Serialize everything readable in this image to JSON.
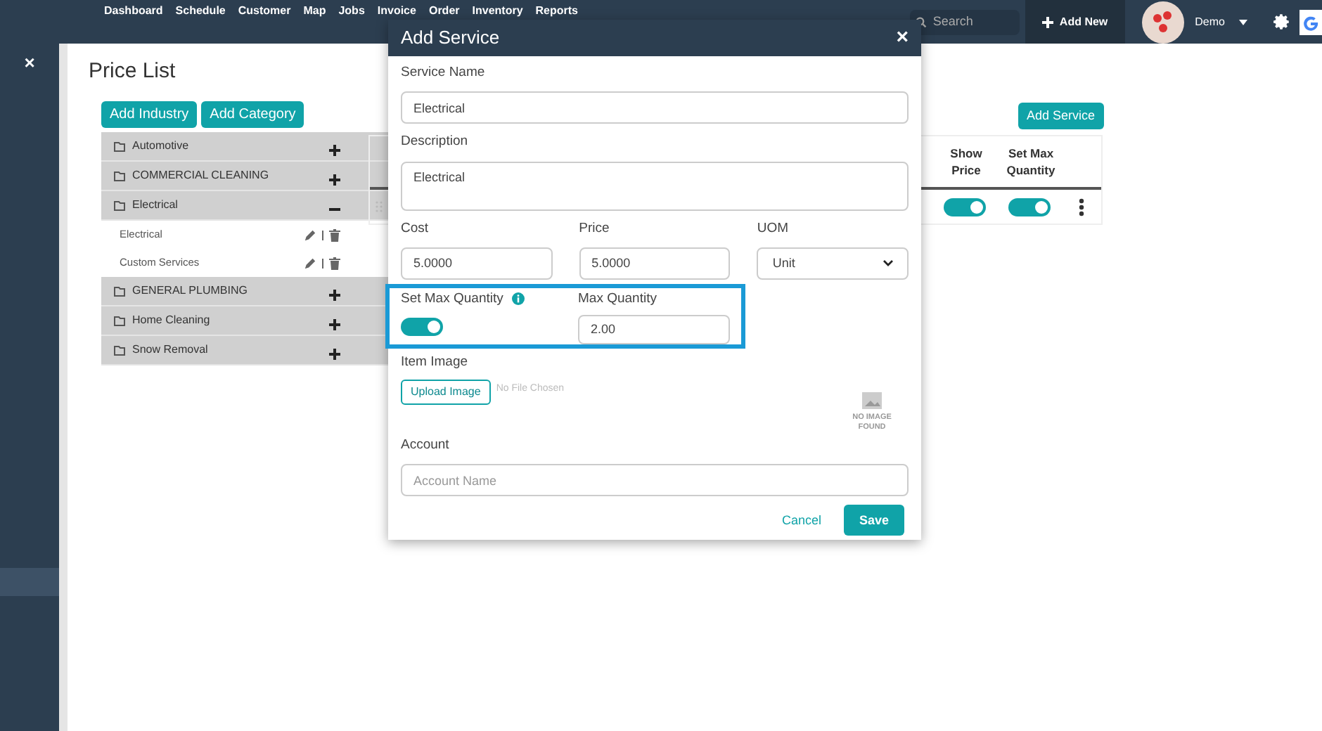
{
  "nav": {
    "items": [
      "Dashboard",
      "Schedule",
      "Customer",
      "Map",
      "Jobs",
      "Invoice",
      "Order",
      "Inventory",
      "Reports"
    ],
    "search": {
      "placeholder": "Search"
    },
    "add_new": "Add New",
    "user": "Demo"
  },
  "sidebar": {
    "close": "×"
  },
  "page": {
    "title": "Price List",
    "buttons": [
      "Add Industry",
      "Add Category"
    ],
    "add_service": "Add Service",
    "categories": [
      {
        "name": "Automotive",
        "expanded": false
      },
      {
        "name": "COMMERCIAL CLEANING",
        "expanded": false
      },
      {
        "name": "Electrical",
        "expanded": true,
        "children": [
          {
            "name": "Electrical"
          },
          {
            "name": "Custom Services"
          }
        ]
      },
      {
        "name": "GENERAL PLUMBING",
        "expanded": false
      },
      {
        "name": "Home Cleaning",
        "expanded": false
      },
      {
        "name": "Snow Removal",
        "expanded": false
      }
    ],
    "table": {
      "columns": [
        "Show Price",
        "Set Max Quantity"
      ],
      "rows": [
        {
          "toggles": [
            {
              "on": true
            },
            {
              "on": true
            }
          ]
        }
      ]
    }
  },
  "modal": {
    "title": "Add Service",
    "close": "×",
    "service_name": {
      "label": "Service Name",
      "value": "Electrical"
    },
    "description": {
      "label": "Description",
      "value": "Electrical"
    },
    "cost": {
      "label": "Cost",
      "value": "5.0000"
    },
    "price": {
      "label": "Price",
      "value": "5.0000"
    },
    "uom": {
      "label": "UOM",
      "value": "Unit"
    },
    "set_max_quantity": {
      "label": "Set Max Quantity",
      "on": true
    },
    "max_quantity": {
      "label": "Max Quantity",
      "value": "2.00"
    },
    "item_image": {
      "label": "Item Image",
      "button": "Upload Image",
      "file": "No File Chosen",
      "no_image": "NO IMAGE FOUND"
    },
    "account": {
      "label": "Account",
      "placeholder": "Account Name"
    },
    "cancel": "Cancel",
    "save": "Save"
  }
}
